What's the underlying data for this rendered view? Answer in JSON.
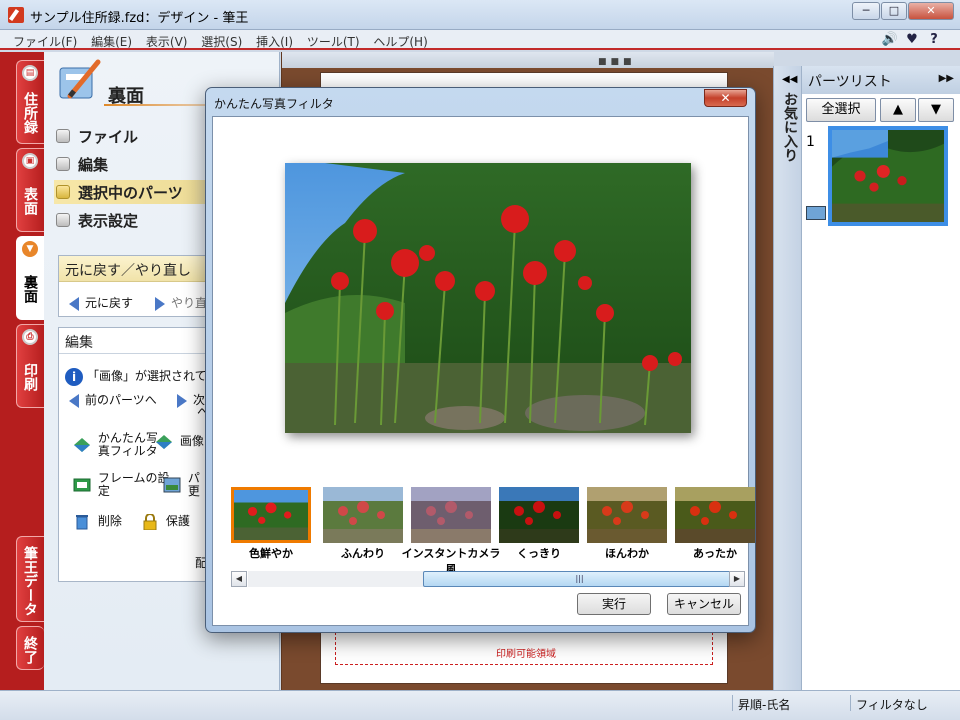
{
  "window": {
    "title": "サンプル住所録.fzd：デザイン - 筆王",
    "minimize": "─",
    "maximize": "□",
    "close": "✕"
  },
  "menu": {
    "items": [
      "ファイル(F)",
      "編集(E)",
      "表示(V)",
      "選択(S)",
      "挿入(I)",
      "ツール(T)",
      "ヘルプ(H)"
    ],
    "toolbar": {
      "sound": "🔊",
      "beginner": "♥",
      "help": "?"
    }
  },
  "left_tabs": {
    "address_book": "住所録",
    "front": "表面",
    "back": "裏面",
    "print": "印刷",
    "data": "筆王データ",
    "exit": "終了"
  },
  "panel": {
    "section_title": "裏面",
    "nav": [
      "ファイル",
      "編集",
      "選択中のパーツ",
      "表示設定"
    ],
    "undo_box": {
      "header": "元に戻す／やり直し",
      "undo": "元に戻す",
      "redo": "やり直"
    },
    "edit_box": {
      "header": "編集",
      "info_text": "「画像」が選択されて",
      "prev_part": "前のパーツへ",
      "next_part_1": "次",
      "next_part_2": "へ",
      "photo_filter_1": "かんたん写",
      "photo_filter_2": "真フィルタ",
      "image_1": "画像",
      "frame_1": "フレームの設",
      "frame_2": "定",
      "parts_change_1": "パ",
      "parts_change_2": "更",
      "delete": "削除",
      "protect": "保護",
      "more": "配"
    }
  },
  "canvas": {
    "print_area_label": "印刷可能領域"
  },
  "favorites": {
    "label": "お気に入り"
  },
  "parts_list": {
    "title": "パーツリスト",
    "select_all": "全選択",
    "up": "▲",
    "down": "▼",
    "item_number": "1"
  },
  "status": {
    "sort": "昇順-氏名",
    "filter": "フィルタなし"
  },
  "dialog": {
    "title": "かんたん写真フィルタ",
    "close": "✕",
    "filters": [
      "色鮮やか",
      "ふんわり",
      "インスタントカメラ風",
      "くっきり",
      "ほんわか",
      "あったか"
    ],
    "selected_filter": "色鮮やか",
    "ok": "実行",
    "cancel": "キャンセル",
    "scroll_left": "◀",
    "scroll_right": "▶",
    "scroll_grip": "|||"
  }
}
